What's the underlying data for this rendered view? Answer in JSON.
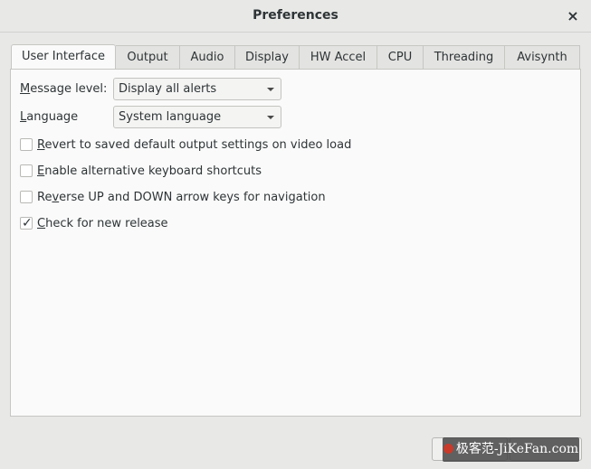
{
  "window": {
    "title": "Preferences",
    "close_glyph": "×"
  },
  "tabs": [
    {
      "label": "User Interface",
      "active": true
    },
    {
      "label": "Output",
      "active": false
    },
    {
      "label": "Audio",
      "active": false
    },
    {
      "label": "Display",
      "active": false
    },
    {
      "label": "HW Accel",
      "active": false
    },
    {
      "label": "CPU",
      "active": false
    },
    {
      "label": "Threading",
      "active": false
    },
    {
      "label": "Avisynth",
      "active": false
    }
  ],
  "settings": {
    "message_level": {
      "label_mnemonic": "M",
      "label_rest": "essage level:",
      "value": "Display all alerts"
    },
    "language": {
      "label_mnemonic": "L",
      "label_rest": "anguage",
      "value": "System language"
    },
    "checkboxes": [
      {
        "mnemonic": "R",
        "rest": "evert to saved default output settings on video load",
        "checked": false
      },
      {
        "mnemonic": "E",
        "rest": "nable alternative keyboard shortcuts",
        "checked": false
      },
      {
        "prefix": "Re",
        "mnemonic": "v",
        "rest": "erse UP and DOWN arrow keys for navigation",
        "checked": false
      },
      {
        "mnemonic": "C",
        "rest": "heck for new release",
        "checked": true
      }
    ],
    "check_glyph": "✓"
  },
  "footer": {
    "watermark_text": "极客范-JiKeFan.com"
  },
  "icons": {
    "close": "close-icon",
    "dropdown": "chevron-down-icon",
    "checkmark": "checkmark-icon"
  }
}
